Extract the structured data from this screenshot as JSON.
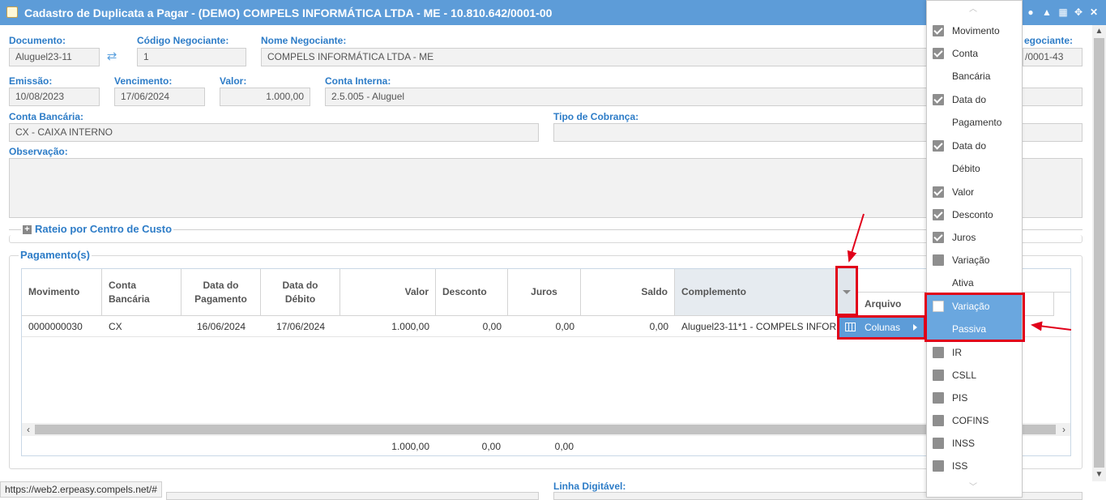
{
  "window": {
    "title": "Cadastro de Duplicata a Pagar - (DEMO) COMPELS INFORMÁTICA LTDA - ME - 10.810.642/0001-00"
  },
  "form": {
    "documento": {
      "label": "Documento:",
      "value": "Aluguel23-11"
    },
    "codigo_negociante": {
      "label": "Código Negociante:",
      "value": "1"
    },
    "nome_negociante": {
      "label": "Nome Negociante:",
      "value": "COMPELS INFORMÁTICA LTDA - ME"
    },
    "cnpj_negociante": {
      "label": "egociante:",
      "value": "/0001-43"
    },
    "emissao": {
      "label": "Emissão:",
      "value": "10/08/2023"
    },
    "vencimento": {
      "label": "Vencimento:",
      "value": "17/06/2024"
    },
    "valor": {
      "label": "Valor:",
      "value": "1.000,00"
    },
    "conta_interna": {
      "label": "Conta Interna:",
      "value": "2.5.005 - Aluguel"
    },
    "conta_bancaria": {
      "label": "Conta Bancária:",
      "value": "CX - CAIXA INTERNO"
    },
    "tipo_cobranca": {
      "label": "Tipo de Cobrança:",
      "value": ""
    },
    "observacao": {
      "label": "Observação:",
      "value": ""
    },
    "linha_digitavel": {
      "label": "Linha Digitável:"
    }
  },
  "sections": {
    "rateio": "Rateio por Centro de Custo",
    "pagamentos": "Pagamento(s)"
  },
  "grid": {
    "headers": {
      "movimento": "Movimento",
      "conta_bancaria": "Conta Bancária",
      "data_pagamento": "Data do Pagamento",
      "data_debito": "Data do Débito",
      "valor": "Valor",
      "desconto": "Desconto",
      "juros": "Juros",
      "saldo": "Saldo",
      "complemento": "Complemento",
      "arquivo": "Arquivo"
    },
    "row": {
      "movimento": "0000000030",
      "conta_bancaria": "CX",
      "data_pagamento": "16/06/2024",
      "data_debito": "17/06/2024",
      "valor": "1.000,00",
      "desconto": "0,00",
      "juros": "0,00",
      "saldo": "0,00",
      "complemento": "Aluguel23-11*1 - COMPELS INFOR"
    },
    "totals": {
      "valor": "1.000,00",
      "desconto": "0,00",
      "juros": "0,00"
    }
  },
  "context_menu": {
    "colunas": "Colunas"
  },
  "columns_menu": {
    "items": [
      {
        "label1": "Movimento",
        "label2": "",
        "state": "checked"
      },
      {
        "label1": "Conta",
        "label2": "Bancária",
        "state": "checked"
      },
      {
        "label1": "Data do",
        "label2": "Pagamento",
        "state": "checked"
      },
      {
        "label1": "Data do",
        "label2": "Débito",
        "state": "checked"
      },
      {
        "label1": "Valor",
        "label2": "",
        "state": "checked"
      },
      {
        "label1": "Desconto",
        "label2": "",
        "state": "checked"
      },
      {
        "label1": "Juros",
        "label2": "",
        "state": "checked"
      },
      {
        "label1": "Variação",
        "label2": "Ativa",
        "state": "unchecked"
      },
      {
        "label1": "Variação",
        "label2": "Passiva",
        "state": "highlighted"
      },
      {
        "label1": "IR",
        "label2": "",
        "state": "unchecked"
      },
      {
        "label1": "CSLL",
        "label2": "",
        "state": "unchecked"
      },
      {
        "label1": "PIS",
        "label2": "",
        "state": "unchecked"
      },
      {
        "label1": "COFINS",
        "label2": "",
        "state": "unchecked"
      },
      {
        "label1": "INSS",
        "label2": "",
        "state": "unchecked"
      },
      {
        "label1": "ISS",
        "label2": "",
        "state": "unchecked"
      }
    ]
  },
  "status_bar": {
    "url": "https://web2.erpeasy.compels.net/#"
  },
  "colors": {
    "accent": "#5d9cd8",
    "label": "#2d7cc7",
    "annotation": "#e1001a"
  },
  "icons": {
    "window": "edit-document-icon",
    "title_buttons": [
      "play-icon",
      "bell-icon",
      "calendar-icon",
      "collapse-icon",
      "close-icon"
    ],
    "refresh": "refresh-icon"
  }
}
